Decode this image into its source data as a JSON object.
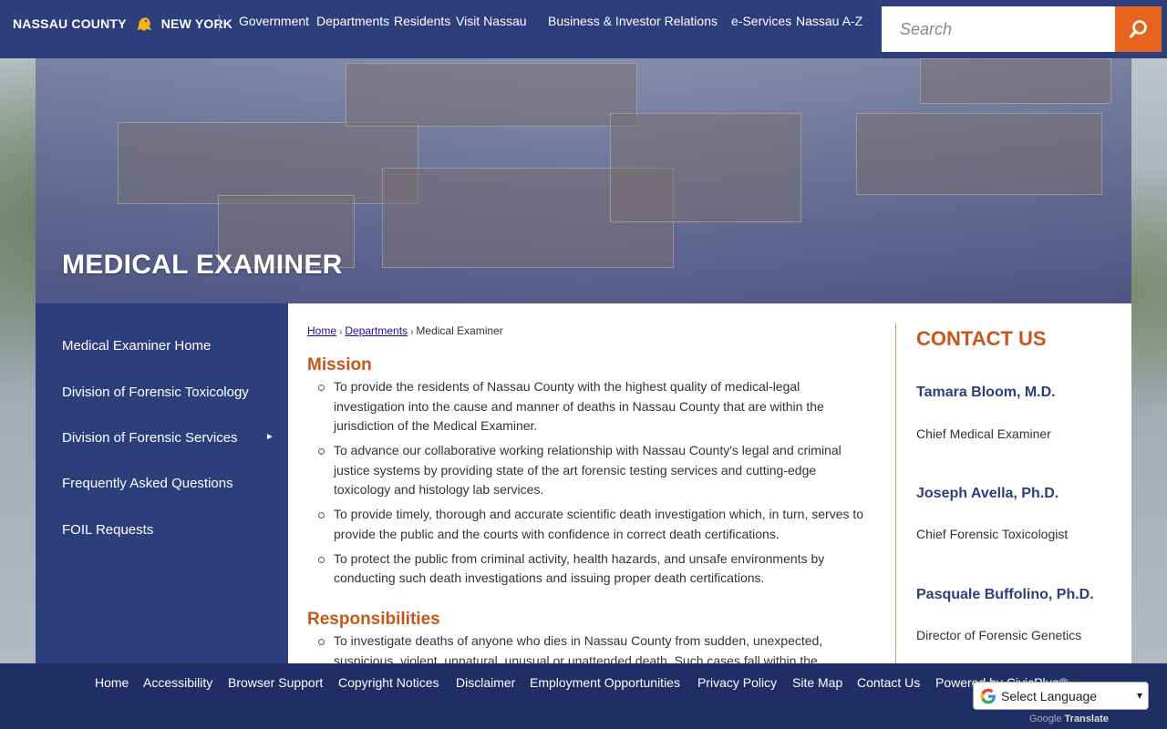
{
  "header": {
    "logo_left": "NASSAU COUNTY",
    "logo_right": "NEW YORK",
    "nav": [
      "Government",
      "Departments",
      "Residents",
      "Visit Nassau",
      "Business & Investor Relations",
      "e-Services",
      "Nassau A-Z"
    ],
    "search_placeholder": "Search"
  },
  "banner": {
    "title": "MEDICAL EXAMINER"
  },
  "sidebar": {
    "items": [
      "Medical Examiner Home",
      "Division of Forensic Toxicology",
      "Division of Forensic Services",
      "Frequently Asked Questions",
      "FOIL Requests"
    ],
    "expand_glyph": "►"
  },
  "breadcrumb": {
    "home": "Home",
    "departments": "Departments",
    "current": "Medical Examiner",
    "sep": "›"
  },
  "mission": {
    "title": "Mission",
    "items": [
      "To provide the residents of Nassau County with the highest quality of medical-legal investigation into the cause and manner of deaths in Nassau County that are within the jurisdiction of the Medical Examiner.",
      "To advance our collaborative working relationship with Nassau County's legal and criminal justice systems by providing state of the art forensic testing services and cutting-edge toxicology and histology lab services.",
      "To provide timely, thorough and accurate scientific death investigation which, in turn, serves to provide the public and the courts with confidence in correct death certifications.",
      "To protect the public from criminal activity, health hazards, and unsafe environments by conducting such death investigations and issuing proper death certifications."
    ]
  },
  "responsibilities": {
    "title": "Responsibilities",
    "items": [
      "To investigate deaths of anyone who dies in Nassau County from sudden, unexpected, suspicious, violent, unnatural, unusual or unattended death. Such cases fall within the"
    ]
  },
  "contact": {
    "title": "CONTACT US",
    "people": [
      {
        "name": "Tamara Bloom, M.D.",
        "role": "Chief Medical Examiner"
      },
      {
        "name": "Joseph Avella, Ph.D.",
        "role": "Chief Forensic Toxicologist"
      },
      {
        "name": "Pasquale Buffolino, Ph.D.",
        "role": "Director of Forensic Genetics"
      }
    ]
  },
  "footer": {
    "links": [
      "Home",
      "Accessibility",
      "Browser Support",
      "Copyright Notices",
      "Disclaimer",
      "Employment Opportunities",
      "Privacy Policy",
      "Site Map",
      "Contact Us",
      "Powered by CivicPlus®"
    ]
  },
  "translate": {
    "label": "Select Language",
    "caret": "▾",
    "powered_prefix": "Google",
    "powered_word": "Translate"
  },
  "colors": {
    "brand_navy": "#2c3f7c",
    "accent_orange": "#e5651f",
    "heading_orange": "#c8561a",
    "footer_navy": "#1f2e64"
  }
}
